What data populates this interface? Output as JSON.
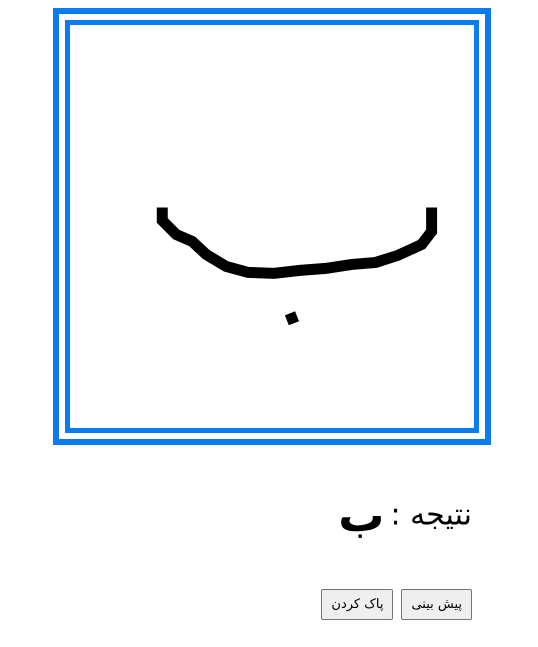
{
  "canvas": {
    "frame_color": "#0a7cf0",
    "stroke_color": "#000000"
  },
  "result": {
    "label": "نتیجه :",
    "value": "ب"
  },
  "buttons": {
    "predict_label": "پیش بینی",
    "clear_label": "پاک کردن"
  }
}
